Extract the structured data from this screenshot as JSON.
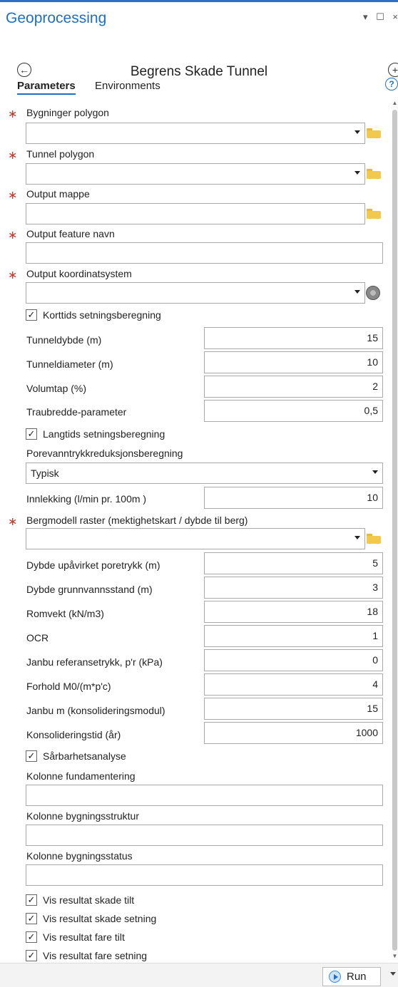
{
  "app": {
    "title": "Geoprocessing",
    "window_controls": "▾ ☐ ×"
  },
  "tool": {
    "title": "Begrens Skade Tunnel"
  },
  "tabs": {
    "parameters": "Parameters",
    "environments": "Environments"
  },
  "params": {
    "bygninger": "Bygninger polygon",
    "tunnel": "Tunnel polygon",
    "output_mappe": "Output mappe",
    "output_feature": "Output feature navn",
    "output_koord": "Output koordinatsystem",
    "bergmodell": "Bergmodell raster (mektighetskart / dybde til berg)",
    "porevann_label": "Porevanntrykkreduksjonsberegning",
    "porevann_value": "Typisk",
    "kolonne_fund": "Kolonne fundamentering",
    "kolonne_struktur": "Kolonne bygningsstruktur",
    "kolonne_status": "Kolonne bygningsstatus"
  },
  "checks": {
    "korttids": "Korttids setningsberegning",
    "langtids": "Langtids setningsberegning",
    "sarbarhet": "Sårbarhetsanalyse",
    "skade_tilt": "Vis resultat skade tilt",
    "skade_setning": "Vis resultat skade setning",
    "fare_tilt": "Vis resultat fare tilt",
    "fare_setning": "Vis resultat fare setning"
  },
  "numeric": {
    "tunneldybde": {
      "label": "Tunneldybde (m)",
      "value": "15"
    },
    "tunneldiameter": {
      "label": "Tunneldiameter (m)",
      "value": "10"
    },
    "volumtap": {
      "label": "Volumtap (%)",
      "value": "2"
    },
    "traubredde": {
      "label": "Traubredde-parameter",
      "value": "0,5"
    },
    "innlekking": {
      "label": "Innlekking (l/min pr. 100m )",
      "value": "10"
    },
    "dybde_upavirket": {
      "label": "Dybde upåvirket poretrykk (m)",
      "value": "5"
    },
    "dybde_grunnvann": {
      "label": "Dybde grunnvannsstand (m)",
      "value": "3"
    },
    "romvekt": {
      "label": "Romvekt (kN/m3)",
      "value": "18"
    },
    "ocr": {
      "label": "OCR",
      "value": "1"
    },
    "janbu_ref": {
      "label": "Janbu referansetrykk, p'r (kPa)",
      "value": "0"
    },
    "forhold": {
      "label": "Forhold M0/(m*p'c)",
      "value": "4"
    },
    "janbu_m": {
      "label": "Janbu m (konsolideringsmodul)",
      "value": "15"
    },
    "konsolidering": {
      "label": "Konsolideringstid (år)",
      "value": "1000"
    }
  },
  "footer": {
    "run_label": "Run"
  },
  "colors": {
    "accent": "#1f6fc5",
    "required": "#c0392b",
    "folder": "#f2c94c"
  }
}
